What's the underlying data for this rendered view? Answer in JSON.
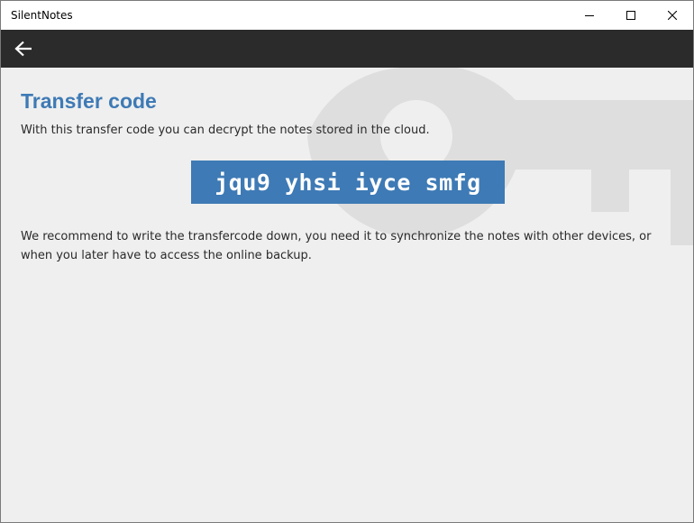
{
  "window": {
    "title": "SilentNotes"
  },
  "caption_buttons": {
    "minimize_icon": "minimize-icon",
    "maximize_icon": "maximize-icon",
    "close_icon": "close-icon"
  },
  "toolbar": {
    "back_icon": "arrow-left-icon"
  },
  "main": {
    "title": "Transfer code",
    "intro": "With this transfer code you can decrypt the notes stored in the cloud.",
    "transfer_code": "jqu9 yhsi iyce smfg",
    "recommendation": "We recommend to write the transfercode down, you need it to synchronize the notes with other devices, or when you later have to access the online backup."
  },
  "colors": {
    "accent": "#3e7ab5",
    "toolbar_bg": "#2b2b2b",
    "page_bg": "#efefef",
    "watermark": "#dedede"
  }
}
